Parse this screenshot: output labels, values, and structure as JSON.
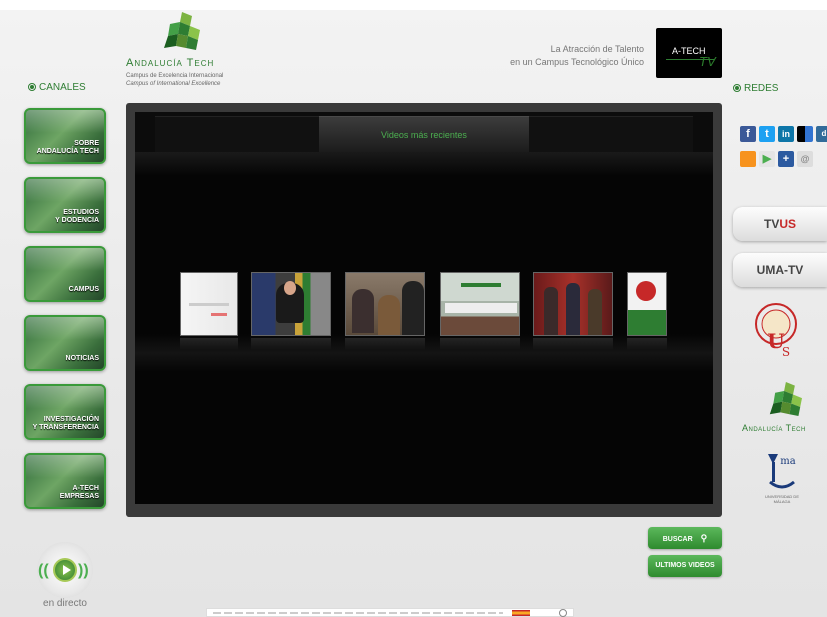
{
  "header": {
    "logo_name": "Andalucía Tech",
    "logo_sub1": "Campus de Excelencia Internacional",
    "logo_sub2": "Campus of International Excellence",
    "tagline_line1": "La Atracción de Talento",
    "tagline_line2": "en un Campus Tecnológico Único",
    "badge_text": "A-TECH",
    "badge_tv": "TV"
  },
  "left": {
    "section_label": "CANALES",
    "channels": [
      {
        "line1": "SOBRE",
        "line2": "ANDALUCÍA TECH"
      },
      {
        "line1": "ESTUDIOS",
        "line2": "Y DODENCIA"
      },
      {
        "line1": "",
        "line2": "CAMPUS"
      },
      {
        "line1": "",
        "line2": "NOTICIAS"
      },
      {
        "line1": "INVESTIGACIÓN",
        "line2": "Y TRANSFERENCIA"
      },
      {
        "line1": "A-TECH",
        "line2": "EMPRESAS"
      }
    ]
  },
  "player": {
    "tab_label": "Videos más recientes"
  },
  "right": {
    "section_label": "REDES",
    "social_icons": [
      "facebook-icon",
      "twitter-icon",
      "linkedin-icon",
      "delicious-icon",
      "digg-icon",
      "rss-icon",
      "youtube-icon",
      "share-icon",
      "email-icon"
    ],
    "tvus_prefix": "TV",
    "tvus_suffix": "US",
    "umatv_label": "UMA-TV",
    "at_name": "Andalucía Tech",
    "uma_text": "UNIVERSIDAD DE MÁLAGA"
  },
  "buttons": {
    "search_label": "BUSCAR",
    "latest_label": "ULTIMOS VIDEOS"
  },
  "live": {
    "label": "en directo"
  },
  "colors": {
    "brand_green": "#2e7d32",
    "player_bg": "#050505",
    "accent_red": "#c62828"
  }
}
